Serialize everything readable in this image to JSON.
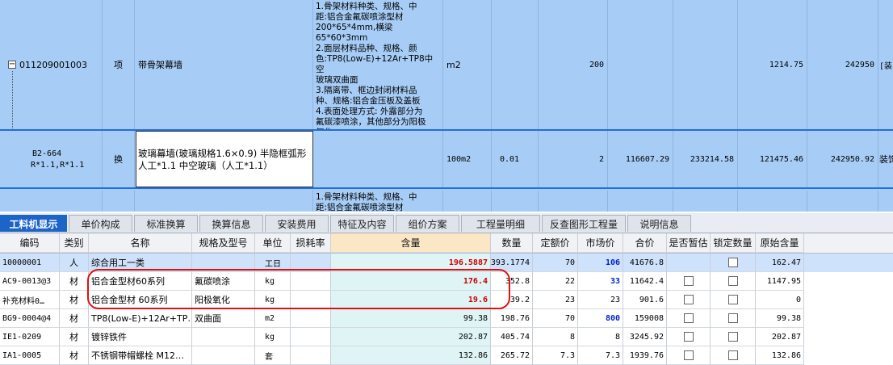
{
  "upper": {
    "row1": {
      "expander": "−",
      "code": "011209001003",
      "type": "项",
      "name": "带骨架幕墙",
      "desc_lines": [
        "1.骨架材料种类、规格、中",
        "距:铝合金氟碳喷涂型材",
        "200*65*4mm,横梁65*60*3mm",
        "2.面层材料品种、规格、颜",
        "色:TP8(Low-E)+12Ar+TP8中空",
        "玻璃双曲面",
        "3.隔离带、框边封闭材料品",
        "种、规格:铝合金压板及盖板",
        "4.表面处理方式: 外露部分为",
        "氟碳漆喷涂，其他部分为阳极",
        "氧化"
      ],
      "unit": "m2",
      "quantity": "200",
      "price": "1214.75",
      "total": "242950",
      "extra": "[装"
    },
    "row2": {
      "code_line1": "B2-664",
      "code_line2": "R*1.1,R*1.1",
      "type": "换",
      "name": "玻璃幕墙(玻璃规格1.6×0.9) 半隐框弧形 人工*1.1  中空玻璃（人工*1.1）",
      "unit": "100m2",
      "content": "0.01",
      "quantity": "2",
      "v1": "116607.29",
      "v2": "233214.58",
      "v3": "121475.46",
      "v4": "242950.92",
      "extra": "装饰"
    },
    "row3": {
      "desc_lines": [
        "1.骨架材料种类、规格、中",
        "距:铝合金氟碳喷涂型材"
      ]
    }
  },
  "tabs": [
    "工料机显示",
    "单价构成",
    "标准换算",
    "换算信息",
    "安装费用",
    "特征及内容",
    "组价方案",
    "工程量明细",
    "反查图形工程量",
    "说明信息"
  ],
  "columns": [
    "编码",
    "类别",
    "名称",
    "规格及型号",
    "单位",
    "损耗率",
    "含量",
    "数量",
    "定额价",
    "市场价",
    "合价",
    "是否暂估",
    "锁定数量",
    "原始含量"
  ],
  "rows": [
    {
      "code": "10000001",
      "cat": "人",
      "name": "综合用工一类",
      "spec": "",
      "unit": "工日",
      "loss": "",
      "content": "196.5887",
      "qty": "393.1774",
      "dprice": "70",
      "mprice": "106",
      "total": "41676.8",
      "est": "",
      "lock": "checkbox",
      "orig": "162.47"
    },
    {
      "code": "AC9-0013@3",
      "cat": "材",
      "name": "铝合金型材60系列",
      "spec": "氟碳喷涂",
      "unit": "kg",
      "loss": "",
      "content": "176.4",
      "qty": "352.8",
      "dprice": "22",
      "mprice": "33",
      "total": "11642.4",
      "est": "checkbox",
      "lock": "checkbox",
      "orig": "1147.95"
    },
    {
      "code": "补充材料0…",
      "cat": "材",
      "name": "铝合金型材 60系列",
      "spec": "阳极氧化",
      "unit": "kg",
      "loss": "",
      "content": "19.6",
      "qty": "39.2",
      "dprice": "23",
      "mprice": "23",
      "total": "901.6",
      "est": "checkbox",
      "lock": "checkbox",
      "orig": "0"
    },
    {
      "code": "BG9-0004@4",
      "cat": "材",
      "name": "TP8(Low-E)+12Ar+TP…",
      "spec": "双曲面",
      "unit": "m2",
      "loss": "",
      "content": "99.38",
      "qty": "198.76",
      "dprice": "70",
      "mprice": "800",
      "total": "159008",
      "est": "checkbox",
      "lock": "checkbox",
      "orig": "99.38"
    },
    {
      "code": "IE1-0209",
      "cat": "材",
      "name": "镀锌铁件",
      "spec": "",
      "unit": "kg",
      "loss": "",
      "content": "202.87",
      "qty": "405.74",
      "dprice": "8",
      "mprice": "8",
      "total": "3245.92",
      "est": "checkbox",
      "lock": "checkbox",
      "orig": "202.87"
    },
    {
      "code": "IA1-0005",
      "cat": "材",
      "name": "不锈钢带帽螺栓 M12…",
      "spec": "",
      "unit": "套",
      "loss": "",
      "content": "132.86",
      "qty": "265.72",
      "dprice": "7.3",
      "mprice": "7.3",
      "total": "1939.76",
      "est": "checkbox",
      "lock": "checkbox",
      "orig": "132.86"
    }
  ],
  "colors": {
    "selection": "#a7cdf7",
    "tab_active": "#1d64c8",
    "content_red": "#d00000",
    "market_blue": "#0022cc",
    "annotation": "#e01010"
  }
}
